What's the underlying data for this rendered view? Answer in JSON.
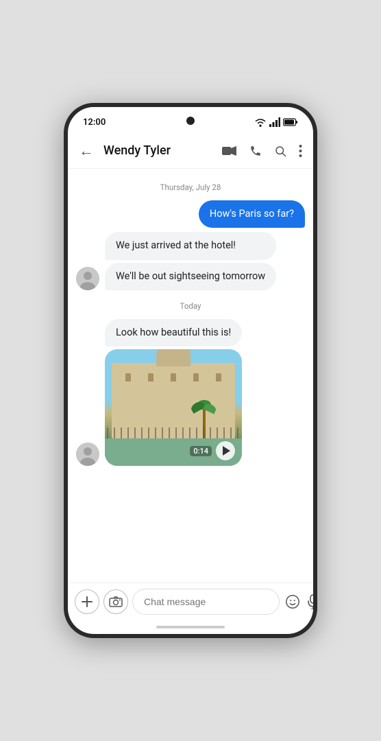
{
  "status": {
    "time": "12:00",
    "wifi": "wifi",
    "signal": "signal",
    "battery": "battery"
  },
  "header": {
    "back_label": "←",
    "title": "Wendy Tyler",
    "video_icon": "video-camera",
    "phone_icon": "phone",
    "search_icon": "search",
    "more_icon": "more-vert"
  },
  "chat": {
    "date_divider_1": "Thursday, July 28",
    "date_divider_2": "Today",
    "messages": [
      {
        "type": "out",
        "text": "How's Paris so far?"
      },
      {
        "type": "in",
        "text": "We just arrived at the hotel!"
      },
      {
        "type": "in",
        "text": "We'll be out sightseeing tomorrow"
      },
      {
        "type": "in-media",
        "text": "Look how beautiful this is!",
        "video_time": "0:14"
      }
    ]
  },
  "input": {
    "placeholder": "Chat message",
    "add_icon": "+",
    "media_icon": "📷",
    "emoji_icon": "😊",
    "mic_icon": "🎤"
  }
}
